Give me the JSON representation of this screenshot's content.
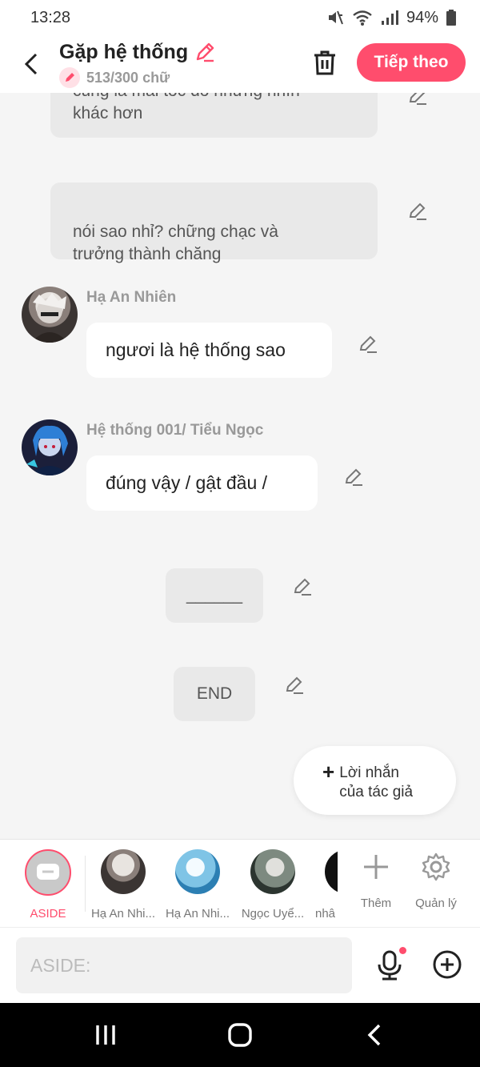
{
  "status": {
    "time": "13:28",
    "battery": "94%"
  },
  "header": {
    "title": "Gặp hệ thống",
    "word_count": "513/300 chữ",
    "next_label": "Tiếp theo"
  },
  "messages": {
    "m1_partial": "cũng là mái tóc đó nhưng nhìn",
    "m1_last": "khác hơn",
    "m2": "nói sao nhỉ? chững chạc và\ntrưởng thành chăng",
    "m3_sender": "Hạ An Nhiên",
    "m3": "ngươi là hệ thống sao",
    "m4_sender": "Hệ thống 001/ Tiểu Ngọc",
    "m4": "đúng vậy / gật đầu /",
    "m5": "______",
    "m6": "END"
  },
  "author_note": {
    "label": "Lời nhắn\ncủa tác giả"
  },
  "characters": {
    "aside": "ASIDE",
    "c1": "Hạ An Nhi...",
    "c2": "Hạ An Nhi...",
    "c3": "Ngọc Uyể...",
    "c4": "nhâ",
    "add": "Thêm",
    "manage": "Quản lý"
  },
  "input": {
    "placeholder": "ASIDE:"
  },
  "colors": {
    "accent": "#ff4d6d",
    "bubble": "#e9e9e9",
    "background": "#f5f5f5"
  }
}
